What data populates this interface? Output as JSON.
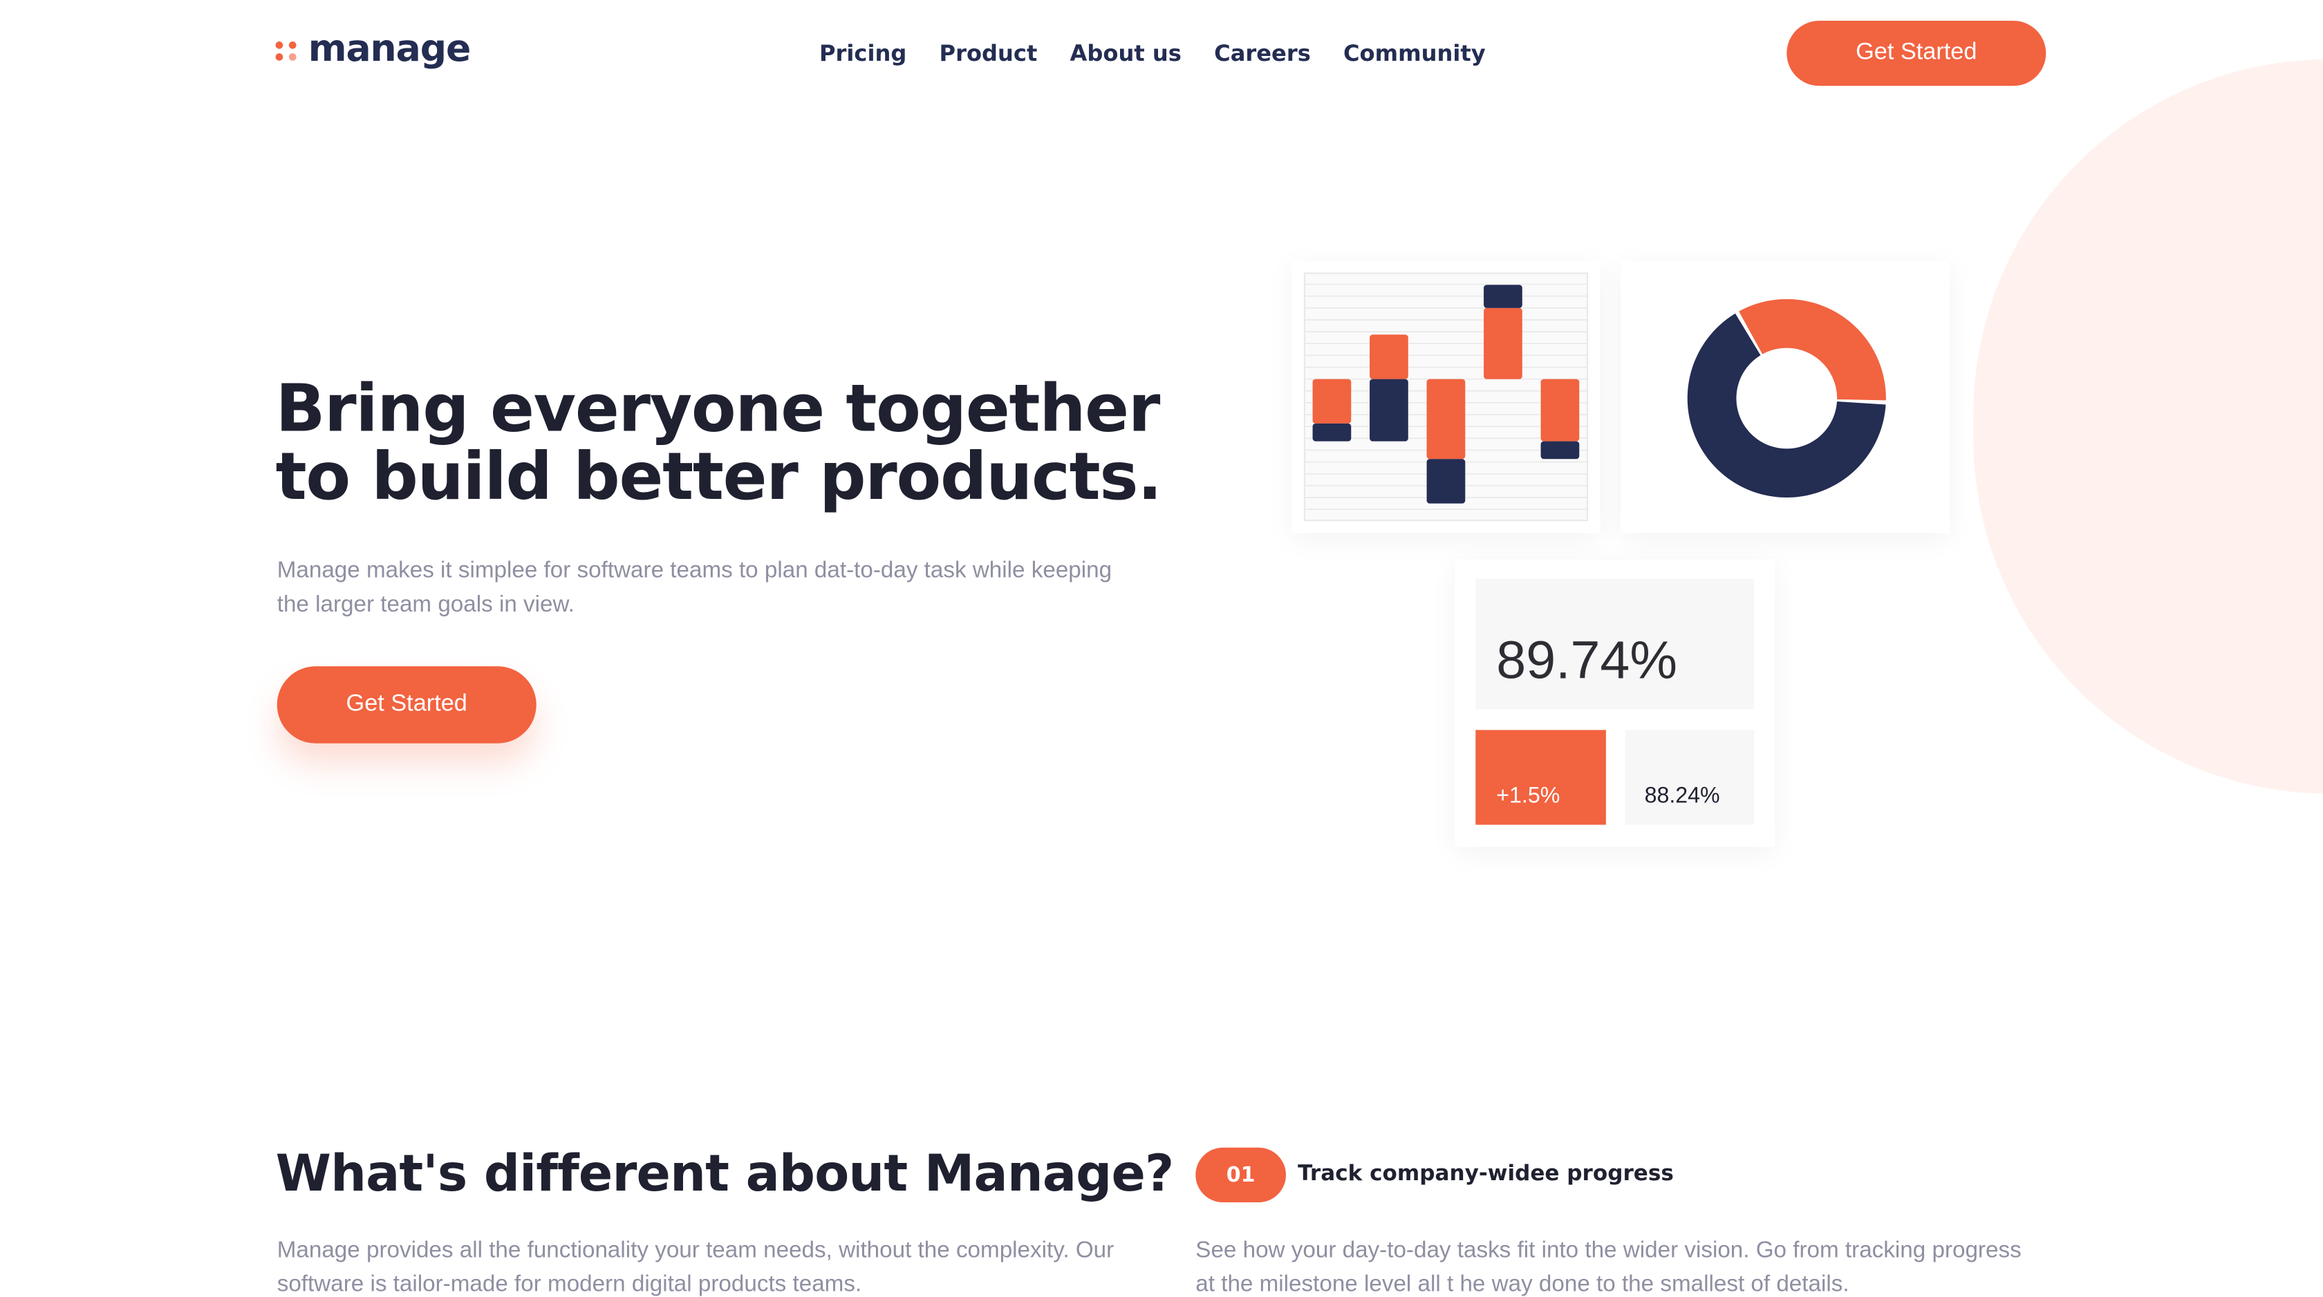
{
  "brand": {
    "name": "manage",
    "accent_color": "#f26340",
    "accent_light": "#f7a08b",
    "navy_color": "#242d52"
  },
  "nav": {
    "items": [
      "Pricing",
      "Product",
      "About us",
      "Careers",
      "Community"
    ],
    "cta_label": "Get Started"
  },
  "hero": {
    "title_line1": "Bring everyone together",
    "title_line2": "to build better products.",
    "description": "Manage makes it simplee for software teams to plan dat-to-day task while keeping the larger team goals in view.",
    "cta_label": "Get Started"
  },
  "chart_data": [
    {
      "type": "bar",
      "title": "",
      "legend": "none",
      "grid": true,
      "baseline": 0,
      "ylim": [
        -8,
        6
      ],
      "series": [
        {
          "color": "#f26340",
          "values": [
            -2.5,
            2.5,
            -4.5,
            4,
            -3.5
          ]
        },
        {
          "color": "#242d52",
          "values": [
            -1,
            -3.5,
            -2.5,
            1.3,
            -1
          ]
        }
      ]
    },
    {
      "type": "pie",
      "title": "",
      "legend": "none",
      "donut": true,
      "series": [
        {
          "color": "#f26340",
          "value": 34
        },
        {
          "color": "#242d52",
          "value": 66
        }
      ]
    }
  ],
  "stats": {
    "main_value": "89.74%",
    "change_value": "+1.5%",
    "secondary_value": "88.24%"
  },
  "section": {
    "title": "What's different about Manage?",
    "description": "Manage provides all the functionality your team needs, without the complexity. Our software is tailor-made for modern digital products teams."
  },
  "feature": {
    "number": "01",
    "title": "Track company-widee progress",
    "description": "See how your day-to-day tasks fit into the wider vision. Go from tracking progress at the milestone level all t he way done to the smallest of details."
  }
}
